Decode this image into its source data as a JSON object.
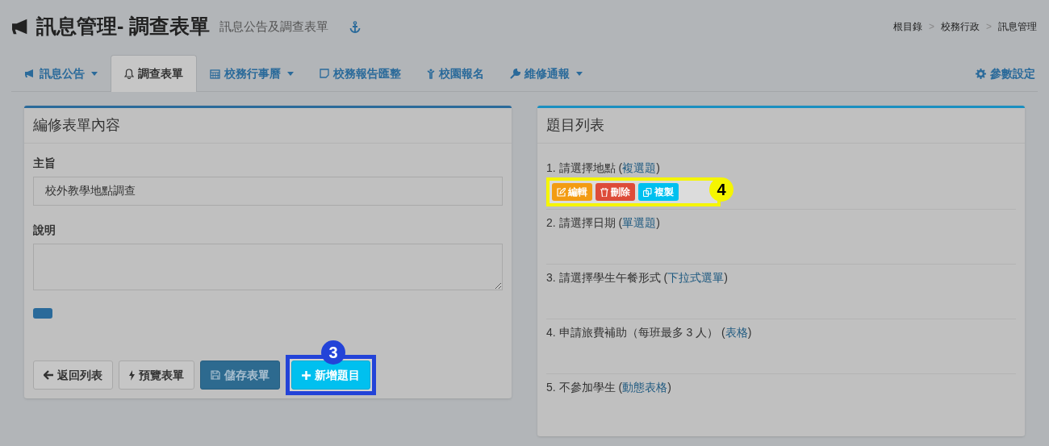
{
  "header": {
    "title": "訊息管理- 調查表單",
    "subtitle": "訊息公告及調查表單"
  },
  "breadcrumb": [
    "根目錄",
    "校務行政",
    "訊息管理"
  ],
  "breadcrumb_separator": ">",
  "tabs": [
    {
      "label": "訊息公告",
      "dropdown": true,
      "selected": false
    },
    {
      "label": "調查表單",
      "dropdown": false,
      "selected": true
    },
    {
      "label": "校務行事曆",
      "dropdown": true,
      "selected": false
    },
    {
      "label": "校務報告匯整",
      "dropdown": false,
      "selected": false
    },
    {
      "label": "校園報名",
      "dropdown": false,
      "selected": false
    },
    {
      "label": "維修通報",
      "dropdown": true,
      "selected": false
    }
  ],
  "settings_tab": {
    "label": "參數設定"
  },
  "form_panel": {
    "title": "編修表單內容",
    "fields": [
      {
        "label": "主旨",
        "value": "校外教學地點調查",
        "kind": "input"
      },
      {
        "label": "說明",
        "kind": "textarea"
      }
    ],
    "buttons": [
      {
        "kind": "back",
        "label": "返回列表"
      },
      {
        "kind": "preview",
        "label": "預覽表單"
      },
      {
        "kind": "save",
        "label": "儲存表單"
      },
      {
        "kind": "add",
        "label": "新增題目",
        "callout": "3"
      }
    ]
  },
  "question_panel": {
    "title": "題目列表",
    "questions": [
      {
        "text": "1. 請選擇地點 (",
        "type": "複選題",
        "close": ")",
        "actions": [
          {
            "kind": "edit",
            "label": "編輯"
          },
          {
            "kind": "delete",
            "label": "刪除"
          },
          {
            "kind": "copy",
            "label": "複製"
          }
        ],
        "callout": "4"
      },
      {
        "text": "2. 請選擇日期 (",
        "type": "單選題",
        "close": ")"
      },
      {
        "text": "3. 請選擇學生午餐形式 (",
        "type": "下拉式選單",
        "close": ")"
      },
      {
        "text": "4. 申請旅費補助（每班最多 3 人） (",
        "type": "表格",
        "close": ")"
      },
      {
        "text": "5. 不參加學生 (",
        "type": "動態表格",
        "close": ")"
      }
    ]
  }
}
